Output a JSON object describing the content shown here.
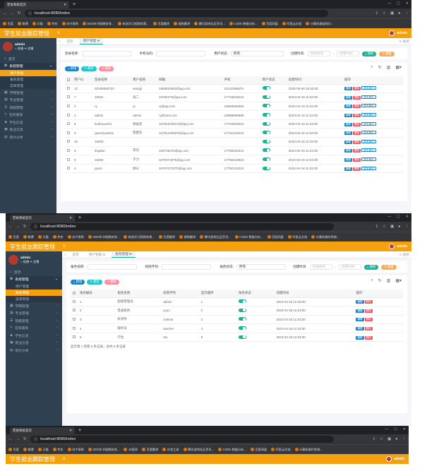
{
  "browser": {
    "tab_title": "若依系统首页",
    "url": "localhost:8080/index",
    "bookmarks": [
      "百度",
      "微博",
      "天猫",
      "京东",
      "苏宁易购",
      "2020年节假期安排...",
      "新浪学习视频车票...",
      "百度翻译",
      "搜狗翻译",
      "腾讯游戏社区资讯...",
      "CSDN 数据分析...",
      "百度网盘",
      "阿里云文档",
      "JS菜单",
      "百度翻译",
      "在线工具",
      "计算机基础知识...",
      "计算机操作系统..."
    ]
  },
  "app": {
    "title": "学生就业跟踪管理",
    "user": "admin",
    "online": "在线",
    "logout": "注销",
    "home": "首页"
  },
  "sidebar": {
    "items": [
      "系统管理",
      "学院管理",
      "专业管理",
      "班级管理",
      "在校表现",
      "学生信息",
      "就业信息",
      "统计分析"
    ],
    "sub": [
      "用户管理",
      "角色管理",
      "菜单管理"
    ]
  },
  "screen1": {
    "tabs": [
      "首页",
      "用户管理"
    ],
    "refresh": "刷新",
    "search": {
      "label1": "登录名称:",
      "label2": "手机号码:",
      "label3": "用户状态:",
      "status_value": "所有",
      "label4": "创建时间:",
      "start_ph": "开始时间",
      "dash": "-",
      "end_ph": "结束时间",
      "search_btn": "搜索",
      "reset_btn": "重置"
    },
    "toolbar": {
      "add": "新增",
      "edit": "修改",
      "del": "删除"
    },
    "headers": [
      "用户ID",
      "登录名称",
      "用户名称",
      "邮箱",
      "手机",
      "用户状态",
      "创建时间",
      "操作"
    ],
    "rows": [
      [
        "12",
        "20180080723",
        "wangji",
        "1565520652@qq.com",
        "15110386875",
        "2023-06-08 18:32:00"
      ],
      [
        "7",
        "16001",
        "张二",
        "16765375@qq.com",
        "17734533210",
        "2023-04-18 11:33:00"
      ],
      [
        "2",
        "ry",
        "ry",
        "ry@qq.com",
        "15666666666",
        "2023-04-18 11:33:00"
      ],
      [
        "1",
        "admin",
        "admin",
        "ry@163.com",
        "15888888888",
        "2023-04-18 11:33:00"
      ],
      [
        "8",
        "liudeyuan01",
        "杨伯友",
        "167912335376@qq.com",
        "17734534534",
        "2023-04-18 11:33:00"
      ],
      [
        "6",
        "gaomiyuan01",
        "管建东",
        "167912335376@qq.com",
        "17751233210",
        "2023-04-18 11:33:00"
      ],
      [
        "10",
        "16003",
        "",
        "",
        "",
        "2023-04-18 11:33:00"
      ],
      [
        "5",
        "lingdan",
        "李丹",
        "163735375@qq.com",
        "17750233210",
        "2023-04-18 11:33:00"
      ],
      [
        "9",
        "16002",
        "子力",
        "1670073275@qq.com",
        "17750133554",
        "2023-04-18 11:33:00"
      ],
      [
        "4",
        "guxin",
        "顾三",
        "16707373270@qq.com",
        "17750133210",
        "2023-04-18 11:33:00"
      ]
    ],
    "actions": [
      "编辑",
      "删除",
      "更多操作"
    ]
  },
  "screen2": {
    "tabs": [
      "首页",
      "用户管理",
      "角色管理"
    ],
    "refresh": "刷新",
    "search": {
      "label1": "角色名称:",
      "label2": "权限字符:",
      "label3": "角色状态:",
      "status_value": "所有",
      "label4": "创建时间:",
      "start_ph": "开始时间",
      "dash": "-",
      "end_ph": "结束时间",
      "search_btn": "搜索",
      "reset_btn": "重置"
    },
    "toolbar": {
      "add": "新增",
      "edit": "修改",
      "del": "删除"
    },
    "headers": [
      "角色编号",
      "角色名称",
      "权限字符",
      "显示顺序",
      "角色状态",
      "创建时间",
      "操作"
    ],
    "rows": [
      [
        "1",
        "超级管理员",
        "admin",
        "1",
        "2023-04-18 11:33:00"
      ],
      [
        "2",
        "普通角色",
        "yuyu",
        "2",
        "2023-04-18 11:33:00"
      ],
      [
        "3",
        "校领导",
        "xxlmas",
        "3",
        "2023-04-18 11:33:00"
      ],
      [
        "4",
        "辅导员",
        "teacher",
        "4",
        "2023-04-18 11:33:00"
      ],
      [
        "5",
        "学生",
        "stu",
        "5",
        "2023-04-18 11:33:00"
      ]
    ],
    "actions": [
      "编辑",
      "删除"
    ],
    "pagination": "显示第 1 到第 5 条记录，总共 5 条记录"
  }
}
